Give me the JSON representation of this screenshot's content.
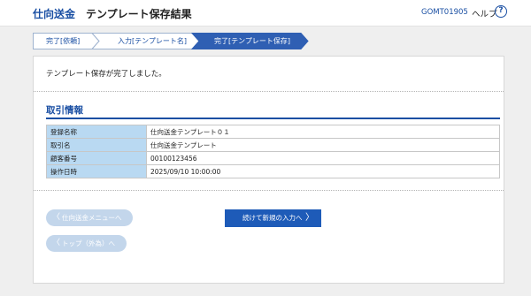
{
  "header": {
    "brand": "仕向送金",
    "title": "テンプレート保存結果",
    "screen_id": "GOMT01905",
    "help_label": "ヘルプ",
    "help_icon": "?"
  },
  "steps": [
    {
      "label": "完了[依頼]",
      "state": "done"
    },
    {
      "label": "入力[テンプレート名]",
      "state": "done"
    },
    {
      "label": "完了[テンプレート保存]",
      "state": "current"
    }
  ],
  "main": {
    "message": "テンプレート保存が完了しました。",
    "section_title": "取引情報",
    "rows": [
      {
        "label": "登録名称",
        "value": "仕向送金テンプレート０１"
      },
      {
        "label": "取引名",
        "value": "仕向送金テンプレート"
      },
      {
        "label": "顧客番号",
        "value": "00100123456"
      },
      {
        "label": "操作日時",
        "value": "2025/09/10 10:00:00"
      }
    ]
  },
  "buttons": {
    "back_menu": "仕向送金メニューへ",
    "back_top": "トップ（外為）へ",
    "continue": "続けて新規の入力へ",
    "chevron_left": "〈",
    "chevron_right": "〉"
  },
  "colors": {
    "brand": "#1a4fa3",
    "step_current": "#2f5fb3",
    "table_header": "#b9d9f2",
    "primary_button": "#1e5bb8",
    "disabled_button": "#c3d6eb"
  }
}
